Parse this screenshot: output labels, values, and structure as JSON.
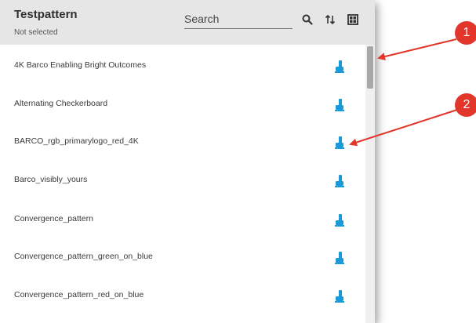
{
  "header": {
    "title": "Testpattern",
    "subtitle": "Not selected",
    "search_placeholder": "Search",
    "buttons": [
      "search-icon",
      "sort-icon",
      "grid-icon"
    ]
  },
  "rows": [
    {
      "label": "4K Barco Enabling Bright Outcomes"
    },
    {
      "label": "Alternating Checkerboard"
    },
    {
      "label": "BARCO_rgb_primarylogo_red_4K"
    },
    {
      "label": "Barco_visibly_yours"
    },
    {
      "label": "Convergence_pattern"
    },
    {
      "label": "Convergence_pattern_green_on_blue"
    },
    {
      "label": "Convergence_pattern_red_on_blue"
    }
  ],
  "callouts": [
    {
      "number": "1",
      "color": "#e2362b"
    },
    {
      "number": "2",
      "color": "#e2362b"
    }
  ],
  "colors": {
    "accent": "#1a9ad8",
    "header_bg": "#e6e6e6",
    "callout": "#e2362b"
  }
}
